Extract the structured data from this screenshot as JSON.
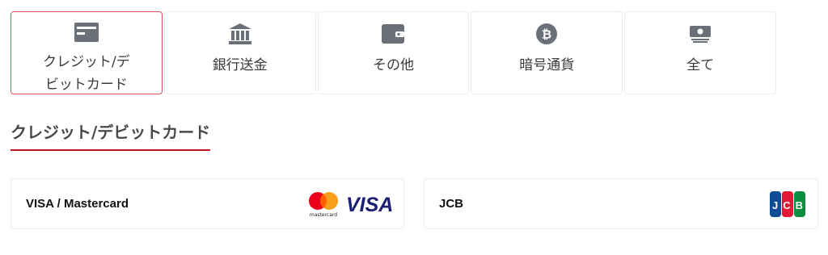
{
  "tabs": [
    {
      "label": "クレジット/デビットカード",
      "icon": "credit-card-icon",
      "active": true
    },
    {
      "label": "銀行送金",
      "icon": "bank-icon",
      "active": false
    },
    {
      "label": "その他",
      "icon": "wallet-icon",
      "active": false
    },
    {
      "label": "暗号通貨",
      "icon": "bitcoin-icon",
      "active": false
    },
    {
      "label": "全て",
      "icon": "cash-icon",
      "active": false
    }
  ],
  "section": {
    "title": "クレジット/デビットカード"
  },
  "methods": [
    {
      "name": "VISA / Mastercard",
      "logos": [
        "mastercard-logo",
        "visa-logo"
      ],
      "mastercard_text": "mastercard",
      "visa_text": "VISA"
    },
    {
      "name": "JCB",
      "logos": [
        "jcb-logo"
      ],
      "jcb_text": "JCB"
    }
  ],
  "colors": {
    "accent": "#c0161e",
    "active_border": "#e0505a",
    "icon": "#6b7078"
  }
}
